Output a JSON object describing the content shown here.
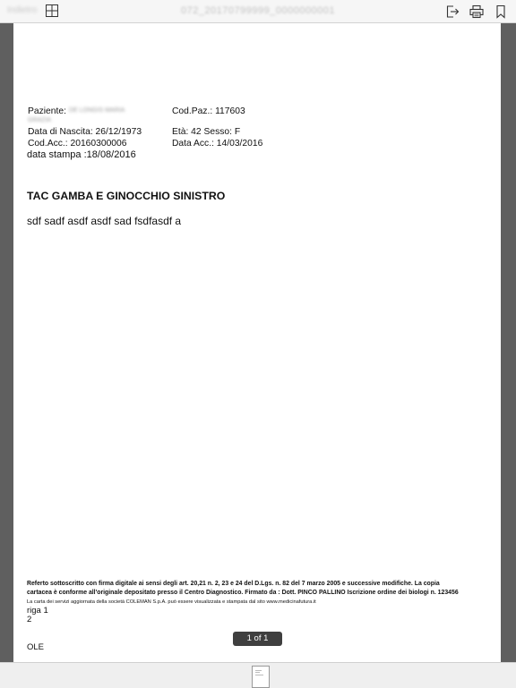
{
  "toolbar": {
    "back_label": "Indietro",
    "title": "072_20170799999_0000000001"
  },
  "patient": {
    "label_patient": "Paziente:",
    "name_blurred_1": "DE LONGIS MARIA",
    "name_blurred_2": "GRAZIA",
    "cod_paz": "Cod.Paz.: 117603",
    "birth": "Data di Nascita: 26/12/1973",
    "age_sex": "Età: 42   Sesso: F",
    "cod_acc": "Cod.Acc.: 20160300006",
    "data_acc": "Data Acc.: 14/03/2016",
    "print_date": "data stampa :18/08/2016"
  },
  "report": {
    "exam_title": "TAC  GAMBA E GINOCCHIO SINISTRO",
    "body": "sdf sadf asdf asdf sad fsdfasdf a"
  },
  "footer": {
    "legal_line1": "Referto sottoscritto con firma digitale ai sensi degli art. 20,21 n. 2, 23 e 24 del D.Lgs. n. 82 del 7 marzo 2005 e successive modifiche. La copia",
    "legal_line2": "cartacea è conforme all'originale depositato presso il Centro Diagnostico. Firmato da : Dott. PINCO PALLINO Iscrizione ordine dei biologi n. 123456",
    "small_note": "La carta dei servizi aggiornata della società COLEMAN S.p.A. può essere visualizzata e stampata dal sito www.medicinafutura.it",
    "riga1": "riga 1",
    "riga2": "2",
    "ole": "OLE"
  },
  "pager": {
    "label": "1 of 1"
  },
  "icons": {
    "grid": "grid-view-icon",
    "share": "share-icon",
    "print": "print-icon",
    "bookmark": "bookmark-icon"
  }
}
